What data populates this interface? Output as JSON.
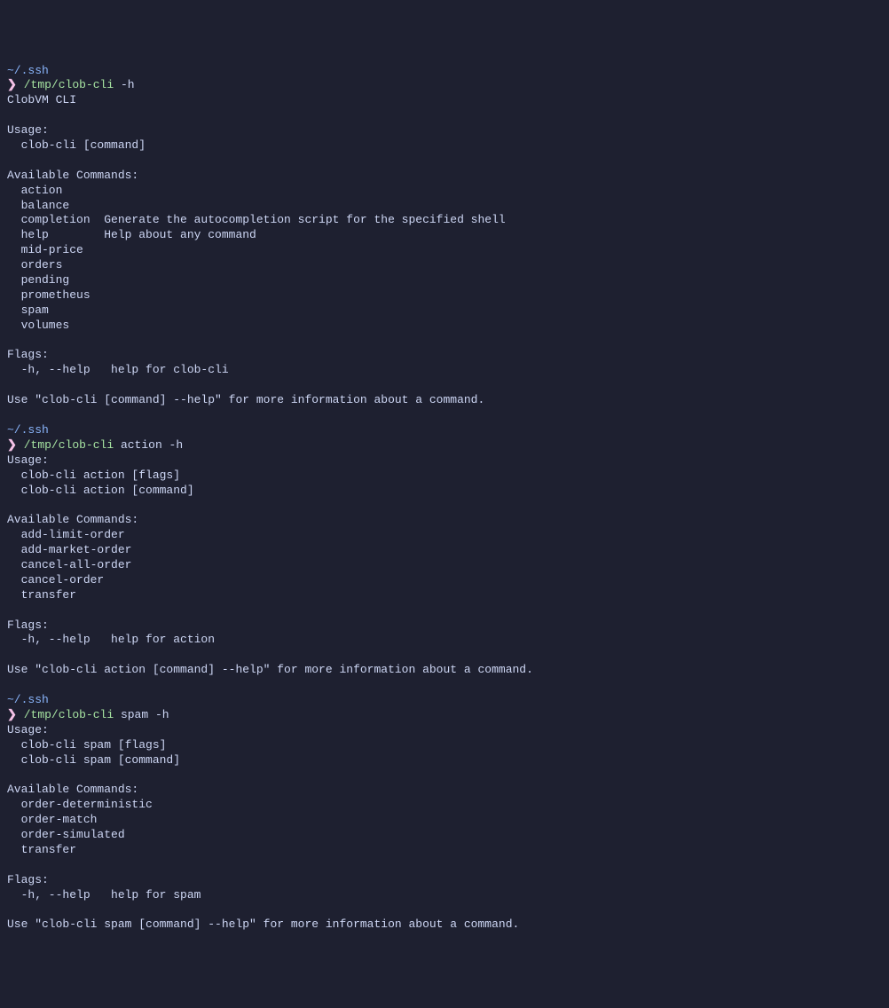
{
  "section1": {
    "cwd": "~/.ssh",
    "prompt_symbol": "❯",
    "command": "/tmp/clob-cli",
    "args": " -h",
    "output": "ClobVM CLI\n\nUsage:\n  clob-cli [command]\n\nAvailable Commands:\n  action\n  balance\n  completion  Generate the autocompletion script for the specified shell\n  help        Help about any command\n  mid-price\n  orders\n  pending\n  prometheus\n  spam\n  volumes\n\nFlags:\n  -h, --help   help for clob-cli\n\nUse \"clob-cli [command] --help\" for more information about a command.\n"
  },
  "section2": {
    "cwd": "~/.ssh",
    "prompt_symbol": "❯",
    "command": "/tmp/clob-cli",
    "args": " action -h",
    "output": "Usage:\n  clob-cli action [flags]\n  clob-cli action [command]\n\nAvailable Commands:\n  add-limit-order\n  add-market-order\n  cancel-all-order\n  cancel-order\n  transfer\n\nFlags:\n  -h, --help   help for action\n\nUse \"clob-cli action [command] --help\" for more information about a command.\n"
  },
  "section3": {
    "cwd": "~/.ssh",
    "prompt_symbol": "❯",
    "command": "/tmp/clob-cli",
    "args": " spam -h",
    "output": "Usage:\n  clob-cli spam [flags]\n  clob-cli spam [command]\n\nAvailable Commands:\n  order-deterministic\n  order-match\n  order-simulated\n  transfer\n\nFlags:\n  -h, --help   help for spam\n\nUse \"clob-cli spam [command] --help\" for more information about a command."
  }
}
